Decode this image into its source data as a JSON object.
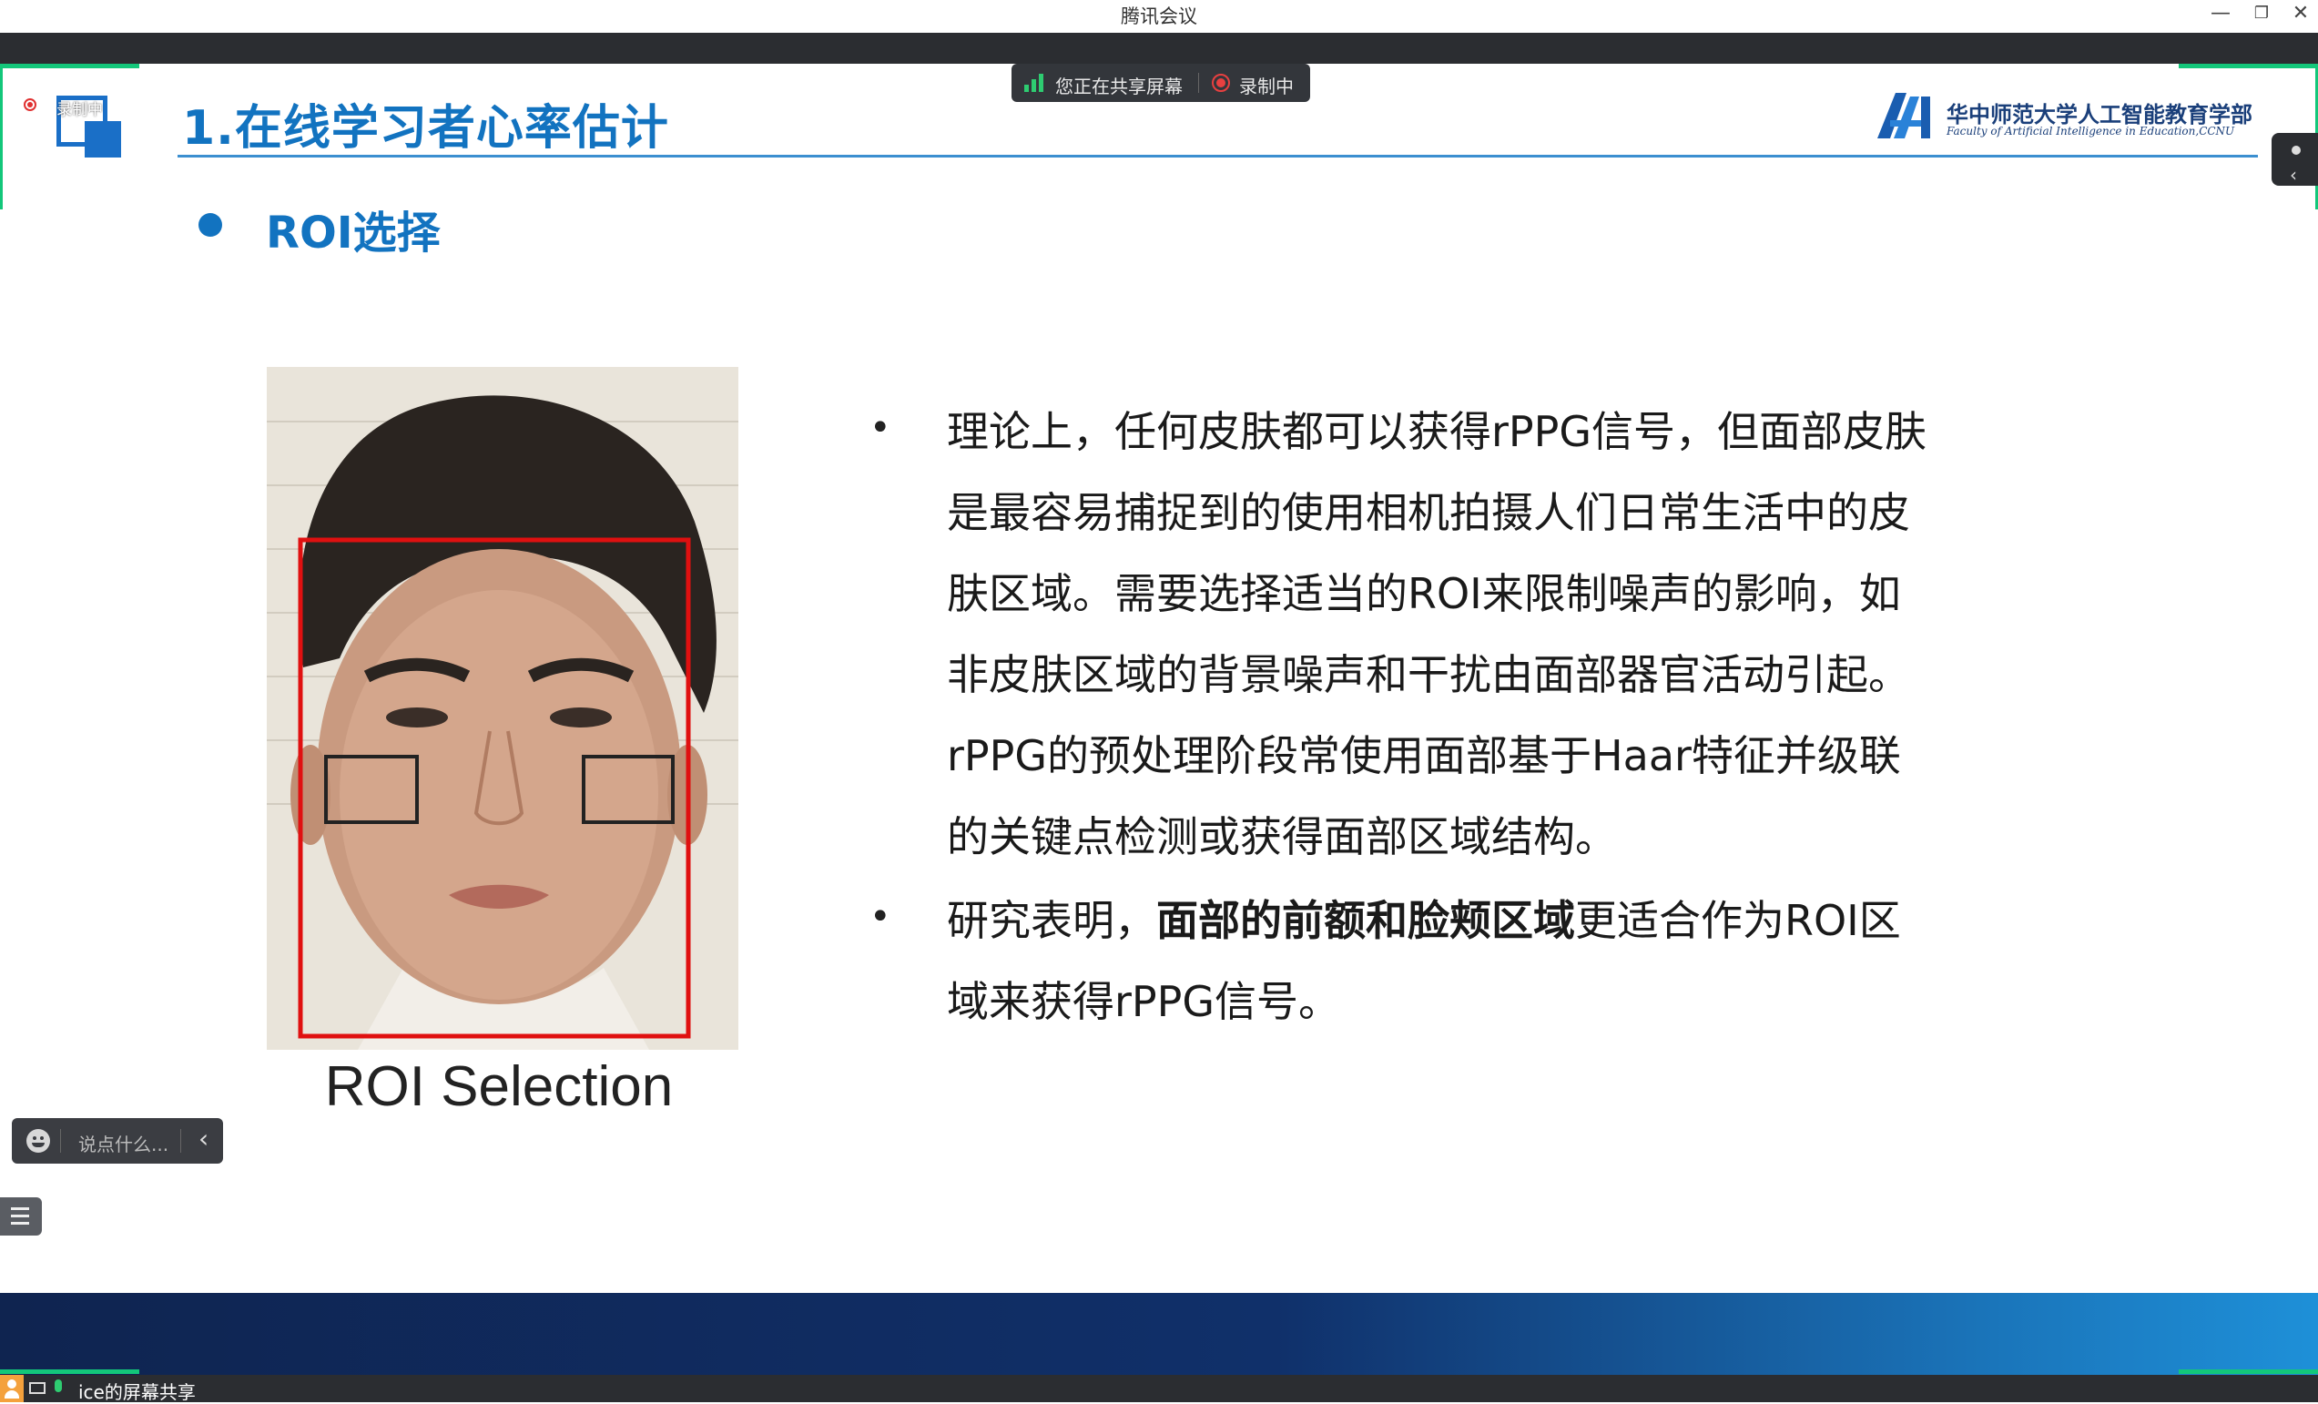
{
  "window": {
    "title": "腾讯会议",
    "minimize_symbol": "—",
    "restore_symbol": "❐",
    "close_symbol": "✕"
  },
  "share_bar": {
    "sharing_text": "您正在共享屏幕",
    "recording_text": "录制中"
  },
  "recording_badge": "录制中",
  "slide": {
    "title": "1.在线学习者心率估计",
    "logo": {
      "cn": "华中师范大学人工智能教育学部",
      "en": "Faculty of Artificial Intelligence in Education,CCNU"
    },
    "section": "ROI选择",
    "photo_caption": "ROI Selection",
    "paragraph1": "理论上，任何皮肤都可以获得rPPG信号，但面部皮肤是最容易捕捉到的使用相机拍摄人们日常生活中的皮肤区域。需要选择适当的ROI来限制噪声的影响，如非皮肤区域的背景噪声和干扰由面部器官活动引起。rPPG的预处理阶段常使用面部基于Haar特征并级联的关键点检测或获得面部区域结构。",
    "paragraph1_lines": [
      "理论上，任何皮肤都可以获得rPPG信号，但面部皮肤",
      "是最容易捕捉到的使用相机拍摄人们日常生活中的皮",
      "肤区域。需要选择适当的ROI来限制噪声的影响，如",
      "非皮肤区域的背景噪声和干扰由面部器官活动引起。",
      "rPPG的预处理阶段常使用面部基于Haar特征并级联",
      "的关键点检测或获得面部区域结构。"
    ],
    "paragraph2_prefix": "研究表明，",
    "paragraph2_bold": "面部的前额和脸颊区域",
    "paragraph2_suffix_line1": "更适合作为ROI区",
    "paragraph2_line2": "域来获得rPPG信号。",
    "bullet_symbol": "•"
  },
  "chat": {
    "placeholder": "说点什么...",
    "emoji_icon": "emoji-icon",
    "collapse_symbol": "‹"
  },
  "bottom_bar": {
    "share_label": "ice的屏幕共享"
  },
  "colors": {
    "accent_blue": "#1273c0",
    "green": "#13c77a",
    "dark": "#2b2d31",
    "roi_red": "#e01010"
  }
}
